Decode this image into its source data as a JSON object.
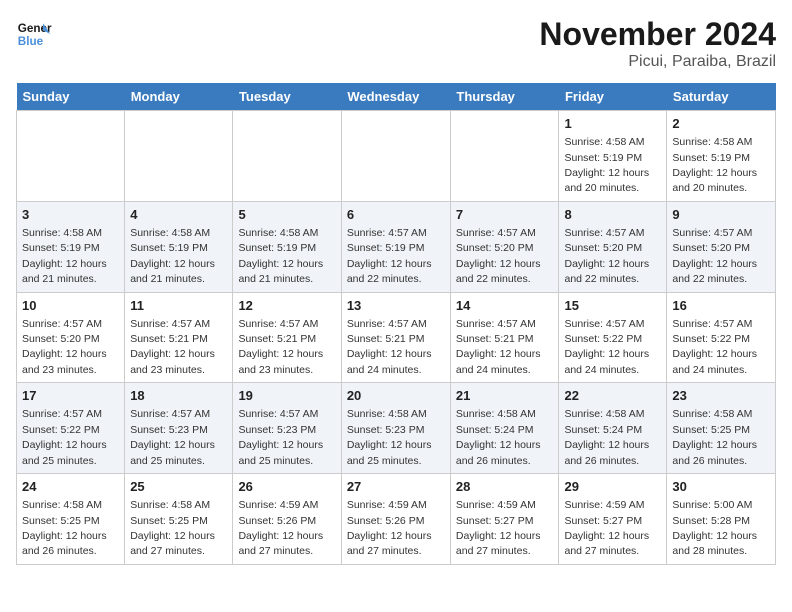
{
  "header": {
    "logo_line1": "General",
    "logo_line2": "Blue",
    "title": "November 2024",
    "subtitle": "Picui, Paraiba, Brazil"
  },
  "weekdays": [
    "Sunday",
    "Monday",
    "Tuesday",
    "Wednesday",
    "Thursday",
    "Friday",
    "Saturday"
  ],
  "weeks": [
    [
      {
        "day": "",
        "info": ""
      },
      {
        "day": "",
        "info": ""
      },
      {
        "day": "",
        "info": ""
      },
      {
        "day": "",
        "info": ""
      },
      {
        "day": "",
        "info": ""
      },
      {
        "day": "1",
        "info": "Sunrise: 4:58 AM\nSunset: 5:19 PM\nDaylight: 12 hours and 20 minutes."
      },
      {
        "day": "2",
        "info": "Sunrise: 4:58 AM\nSunset: 5:19 PM\nDaylight: 12 hours and 20 minutes."
      }
    ],
    [
      {
        "day": "3",
        "info": "Sunrise: 4:58 AM\nSunset: 5:19 PM\nDaylight: 12 hours and 21 minutes."
      },
      {
        "day": "4",
        "info": "Sunrise: 4:58 AM\nSunset: 5:19 PM\nDaylight: 12 hours and 21 minutes."
      },
      {
        "day": "5",
        "info": "Sunrise: 4:58 AM\nSunset: 5:19 PM\nDaylight: 12 hours and 21 minutes."
      },
      {
        "day": "6",
        "info": "Sunrise: 4:57 AM\nSunset: 5:19 PM\nDaylight: 12 hours and 22 minutes."
      },
      {
        "day": "7",
        "info": "Sunrise: 4:57 AM\nSunset: 5:20 PM\nDaylight: 12 hours and 22 minutes."
      },
      {
        "day": "8",
        "info": "Sunrise: 4:57 AM\nSunset: 5:20 PM\nDaylight: 12 hours and 22 minutes."
      },
      {
        "day": "9",
        "info": "Sunrise: 4:57 AM\nSunset: 5:20 PM\nDaylight: 12 hours and 22 minutes."
      }
    ],
    [
      {
        "day": "10",
        "info": "Sunrise: 4:57 AM\nSunset: 5:20 PM\nDaylight: 12 hours and 23 minutes."
      },
      {
        "day": "11",
        "info": "Sunrise: 4:57 AM\nSunset: 5:21 PM\nDaylight: 12 hours and 23 minutes."
      },
      {
        "day": "12",
        "info": "Sunrise: 4:57 AM\nSunset: 5:21 PM\nDaylight: 12 hours and 23 minutes."
      },
      {
        "day": "13",
        "info": "Sunrise: 4:57 AM\nSunset: 5:21 PM\nDaylight: 12 hours and 24 minutes."
      },
      {
        "day": "14",
        "info": "Sunrise: 4:57 AM\nSunset: 5:21 PM\nDaylight: 12 hours and 24 minutes."
      },
      {
        "day": "15",
        "info": "Sunrise: 4:57 AM\nSunset: 5:22 PM\nDaylight: 12 hours and 24 minutes."
      },
      {
        "day": "16",
        "info": "Sunrise: 4:57 AM\nSunset: 5:22 PM\nDaylight: 12 hours and 24 minutes."
      }
    ],
    [
      {
        "day": "17",
        "info": "Sunrise: 4:57 AM\nSunset: 5:22 PM\nDaylight: 12 hours and 25 minutes."
      },
      {
        "day": "18",
        "info": "Sunrise: 4:57 AM\nSunset: 5:23 PM\nDaylight: 12 hours and 25 minutes."
      },
      {
        "day": "19",
        "info": "Sunrise: 4:57 AM\nSunset: 5:23 PM\nDaylight: 12 hours and 25 minutes."
      },
      {
        "day": "20",
        "info": "Sunrise: 4:58 AM\nSunset: 5:23 PM\nDaylight: 12 hours and 25 minutes."
      },
      {
        "day": "21",
        "info": "Sunrise: 4:58 AM\nSunset: 5:24 PM\nDaylight: 12 hours and 26 minutes."
      },
      {
        "day": "22",
        "info": "Sunrise: 4:58 AM\nSunset: 5:24 PM\nDaylight: 12 hours and 26 minutes."
      },
      {
        "day": "23",
        "info": "Sunrise: 4:58 AM\nSunset: 5:25 PM\nDaylight: 12 hours and 26 minutes."
      }
    ],
    [
      {
        "day": "24",
        "info": "Sunrise: 4:58 AM\nSunset: 5:25 PM\nDaylight: 12 hours and 26 minutes."
      },
      {
        "day": "25",
        "info": "Sunrise: 4:58 AM\nSunset: 5:25 PM\nDaylight: 12 hours and 27 minutes."
      },
      {
        "day": "26",
        "info": "Sunrise: 4:59 AM\nSunset: 5:26 PM\nDaylight: 12 hours and 27 minutes."
      },
      {
        "day": "27",
        "info": "Sunrise: 4:59 AM\nSunset: 5:26 PM\nDaylight: 12 hours and 27 minutes."
      },
      {
        "day": "28",
        "info": "Sunrise: 4:59 AM\nSunset: 5:27 PM\nDaylight: 12 hours and 27 minutes."
      },
      {
        "day": "29",
        "info": "Sunrise: 4:59 AM\nSunset: 5:27 PM\nDaylight: 12 hours and 27 minutes."
      },
      {
        "day": "30",
        "info": "Sunrise: 5:00 AM\nSunset: 5:28 PM\nDaylight: 12 hours and 28 minutes."
      }
    ]
  ]
}
